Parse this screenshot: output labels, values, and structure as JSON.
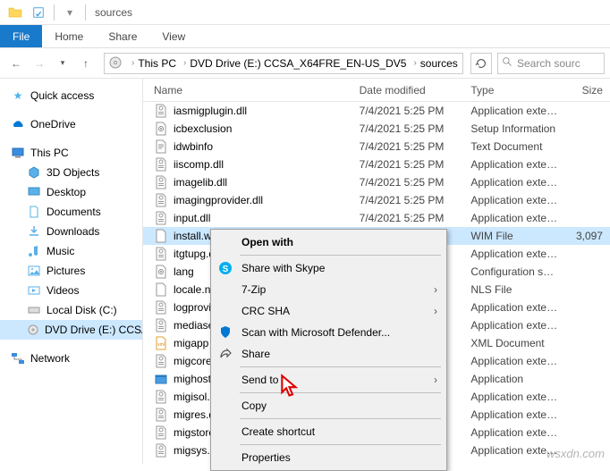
{
  "titlebar": {
    "title": "sources"
  },
  "ribbon": {
    "file": "File",
    "tabs": [
      "Home",
      "Share",
      "View"
    ]
  },
  "breadcrumb": [
    "This PC",
    "DVD Drive (E:) CCSA_X64FRE_EN-US_DV5",
    "sources"
  ],
  "search_placeholder": "Search sourc",
  "tree": {
    "quick": "Quick access",
    "onedrive": "OneDrive",
    "pc": "This PC",
    "children": [
      "3D Objects",
      "Desktop",
      "Documents",
      "Downloads",
      "Music",
      "Pictures",
      "Videos",
      "Local Disk (C:)",
      "DVD Drive (E:) CCSA"
    ],
    "network": "Network"
  },
  "columns": {
    "name": "Name",
    "date": "Date modified",
    "type": "Type",
    "size": "Size"
  },
  "files": [
    {
      "name": "iasmigplugin.dll",
      "date": "7/4/2021 5:25 PM",
      "type": "Application exten...",
      "size": "",
      "icon": "dll"
    },
    {
      "name": "icbexclusion",
      "date": "7/4/2021 5:25 PM",
      "type": "Setup Information",
      "size": "",
      "icon": "ini"
    },
    {
      "name": "idwbinfo",
      "date": "7/4/2021 5:25 PM",
      "type": "Text Document",
      "size": "",
      "icon": "txt"
    },
    {
      "name": "iiscomp.dll",
      "date": "7/4/2021 5:25 PM",
      "type": "Application exten...",
      "size": "",
      "icon": "dll"
    },
    {
      "name": "imagelib.dll",
      "date": "7/4/2021 5:25 PM",
      "type": "Application exten...",
      "size": "",
      "icon": "dll"
    },
    {
      "name": "imagingprovider.dll",
      "date": "7/4/2021 5:25 PM",
      "type": "Application exten...",
      "size": "",
      "icon": "dll"
    },
    {
      "name": "input.dll",
      "date": "7/4/2021 5:25 PM",
      "type": "Application exten...",
      "size": "",
      "icon": "dll"
    },
    {
      "name": "install.wim",
      "date": "7/4/2021 5:25 PM",
      "type": "WIM File",
      "size": "3,097",
      "icon": "file",
      "selected": true
    },
    {
      "name": "itgtupg.dll",
      "date": "",
      "type": "Application exten...",
      "size": "",
      "icon": "dll"
    },
    {
      "name": "lang",
      "date": "",
      "type": "Configuration sett...",
      "size": "",
      "icon": "ini"
    },
    {
      "name": "locale.nls",
      "date": "",
      "type": "NLS File",
      "size": "",
      "icon": "file"
    },
    {
      "name": "logprovide",
      "date": "",
      "type": "Application exten...",
      "size": "",
      "icon": "dll"
    },
    {
      "name": "mediasetu",
      "date": "",
      "type": "Application exten...",
      "size": "",
      "icon": "dll"
    },
    {
      "name": "migapp",
      "date": "",
      "type": "XML Document",
      "size": "",
      "icon": "xml"
    },
    {
      "name": "migcore.dl",
      "date": "",
      "type": "Application exten...",
      "size": "",
      "icon": "dll"
    },
    {
      "name": "mighost",
      "date": "",
      "type": "Application",
      "size": "",
      "icon": "exe"
    },
    {
      "name": "migisol.dll",
      "date": "",
      "type": "Application exten...",
      "size": "",
      "icon": "dll"
    },
    {
      "name": "migres.dll",
      "date": "",
      "type": "Application exten...",
      "size": "",
      "icon": "dll"
    },
    {
      "name": "migstore.d",
      "date": "",
      "type": "Application exten...",
      "size": "",
      "icon": "dll"
    },
    {
      "name": "migsys.dll",
      "date": "",
      "type": "Application exten...",
      "size": "",
      "icon": "dll"
    }
  ],
  "context_menu": {
    "open_with": "Open with",
    "skype": "Share with Skype",
    "seven_zip": "7-Zip",
    "crc": "CRC SHA",
    "defender": "Scan with Microsoft Defender...",
    "share": "Share",
    "send_to": "Send to",
    "copy": "Copy",
    "shortcut": "Create shortcut",
    "properties": "Properties"
  },
  "watermark": "wsxdn.com"
}
